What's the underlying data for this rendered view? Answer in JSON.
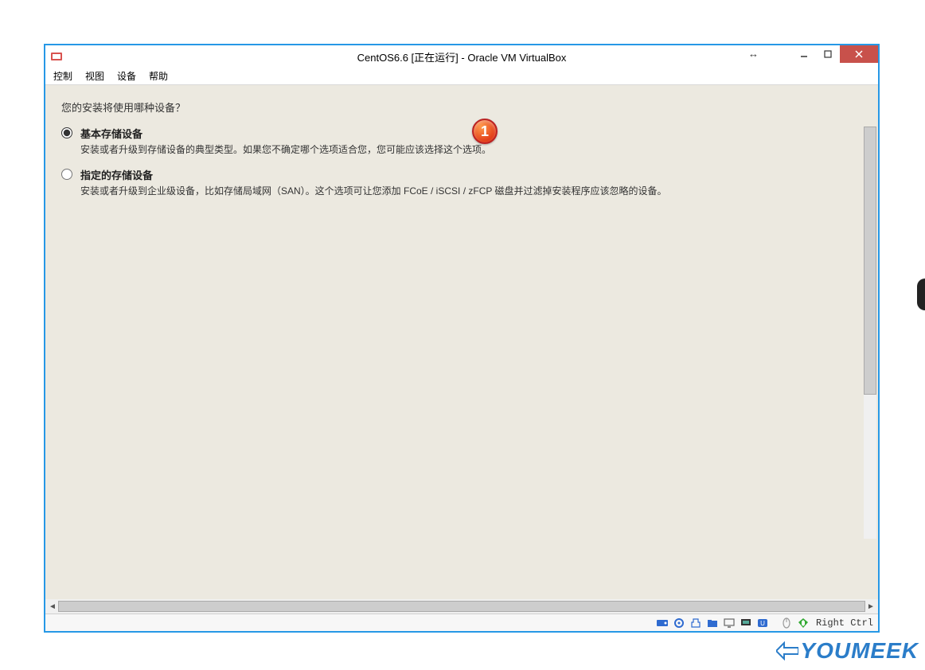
{
  "window": {
    "title": "CentOS6.6 [正在运行] - Oracle VM VirtualBox"
  },
  "menu": {
    "items": [
      "控制",
      "视图",
      "设备",
      "帮助"
    ]
  },
  "installer": {
    "question": "您的安装将使用哪种设备？",
    "options": [
      {
        "title": "基本存储设备",
        "desc": "安装或者升级到存储设备的典型类型。如果您不确定哪个选项适合您，您可能应该选择这个选项。",
        "selected": true
      },
      {
        "title": "指定的存储设备",
        "desc": "安装或者升级到企业级设备，比如存储局域网（SAN）。这个选项可让您添加 FCoE / iSCSI / zFCP 磁盘并过滤掉安装程序应该忽略的设备。",
        "selected": false
      }
    ],
    "badge": "1"
  },
  "status": {
    "host_key": "Right Ctrl"
  },
  "watermark": "YOUMEEK"
}
